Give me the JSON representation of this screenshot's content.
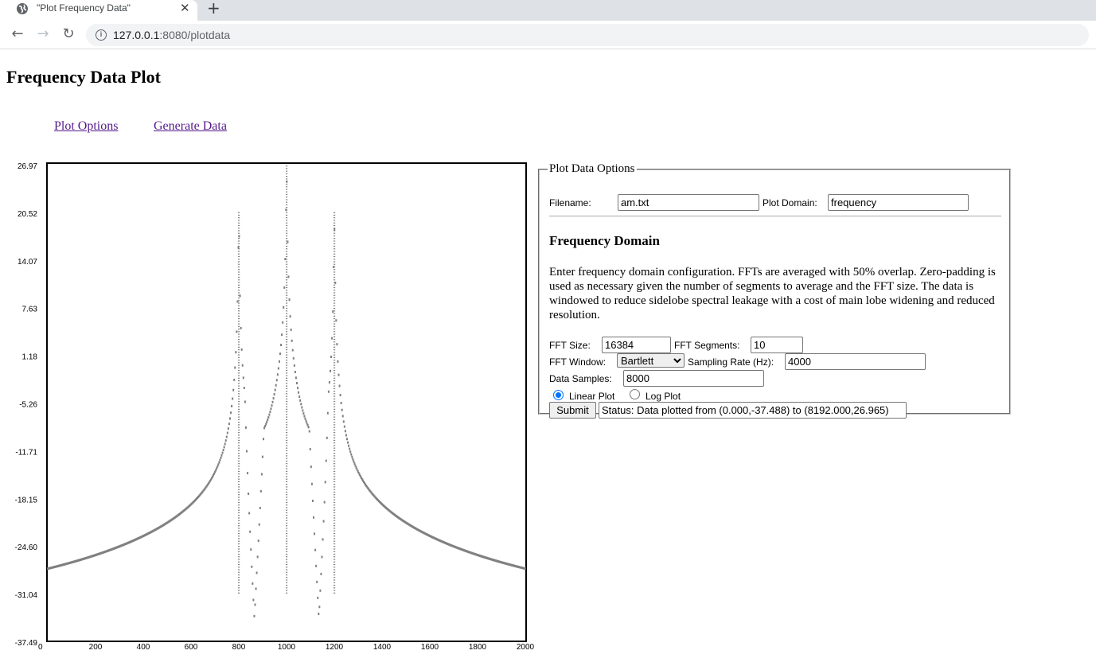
{
  "browser": {
    "tab_title": "\"Plot Frequency Data\"",
    "close_glyph": "✕",
    "new_tab_glyph": "+",
    "back_glyph": "←",
    "forward_glyph": "→",
    "reload_glyph": "↻",
    "url_host": "127.0.0.1",
    "url_rest": ":8080/plotdata"
  },
  "page": {
    "title": "Frequency Data Plot",
    "links": {
      "plot_options": "Plot Options",
      "generate_data": "Generate Data"
    }
  },
  "options": {
    "legend": "Plot Data Options",
    "filename_label": "Filename:",
    "filename_value": "am.txt",
    "domain_label": "Plot Domain:",
    "domain_value": "frequency",
    "heading": "Frequency Domain",
    "description": "Enter frequency domain configuration. FFTs are averaged with 50% overlap. Zero-padding is used as necessary given the number of segments to average and the FFT size. The data is windowed to reduce sidelobe spectral leakage with a cost of main lobe widening and reduced resolution.",
    "fft_size_label": "FFT Size:",
    "fft_size_value": "16384",
    "fft_segments_label": "FFT Segments:",
    "fft_segments_value": "10",
    "fft_window_label": "FFT Window:",
    "fft_window_value": "Bartlett",
    "sampling_rate_label": "Sampling Rate (Hz):",
    "sampling_rate_value": "4000",
    "data_samples_label": "Data Samples:",
    "data_samples_value": "8000",
    "radio_linear_label": "Linear Plot",
    "radio_log_label": "Log Plot",
    "plot_scale_selected": "linear",
    "submit_label": "Submit",
    "status_value": "Status: Data plotted from (0.000,-37.488) to (8192.000,26.965)"
  },
  "chart_data": {
    "type": "scatter",
    "color": "#808080",
    "ylim": [
      -37.49,
      26.97
    ],
    "xlim": [
      0,
      2000
    ],
    "y_ticks": [
      "26.97",
      "20.52",
      "14.07",
      "7.63",
      "1.18",
      "-5.26",
      "-11.71",
      "-18.15",
      "-24.60",
      "-31.04",
      "-37.49"
    ],
    "x_ticks": [
      "0",
      "200",
      "400",
      "600",
      "800",
      "1000",
      "1200",
      "1400",
      "1600",
      "1800",
      "2000"
    ],
    "peaks": [
      {
        "freq": 800,
        "value": 20.5
      },
      {
        "freq": 1000,
        "value": 26.97
      },
      {
        "freq": 1200,
        "value": 20.5
      }
    ],
    "notches": [
      {
        "freq": 865,
        "value": -34.5
      },
      {
        "freq": 1135,
        "value": -34.5
      }
    ],
    "baseline": -37.0
  }
}
